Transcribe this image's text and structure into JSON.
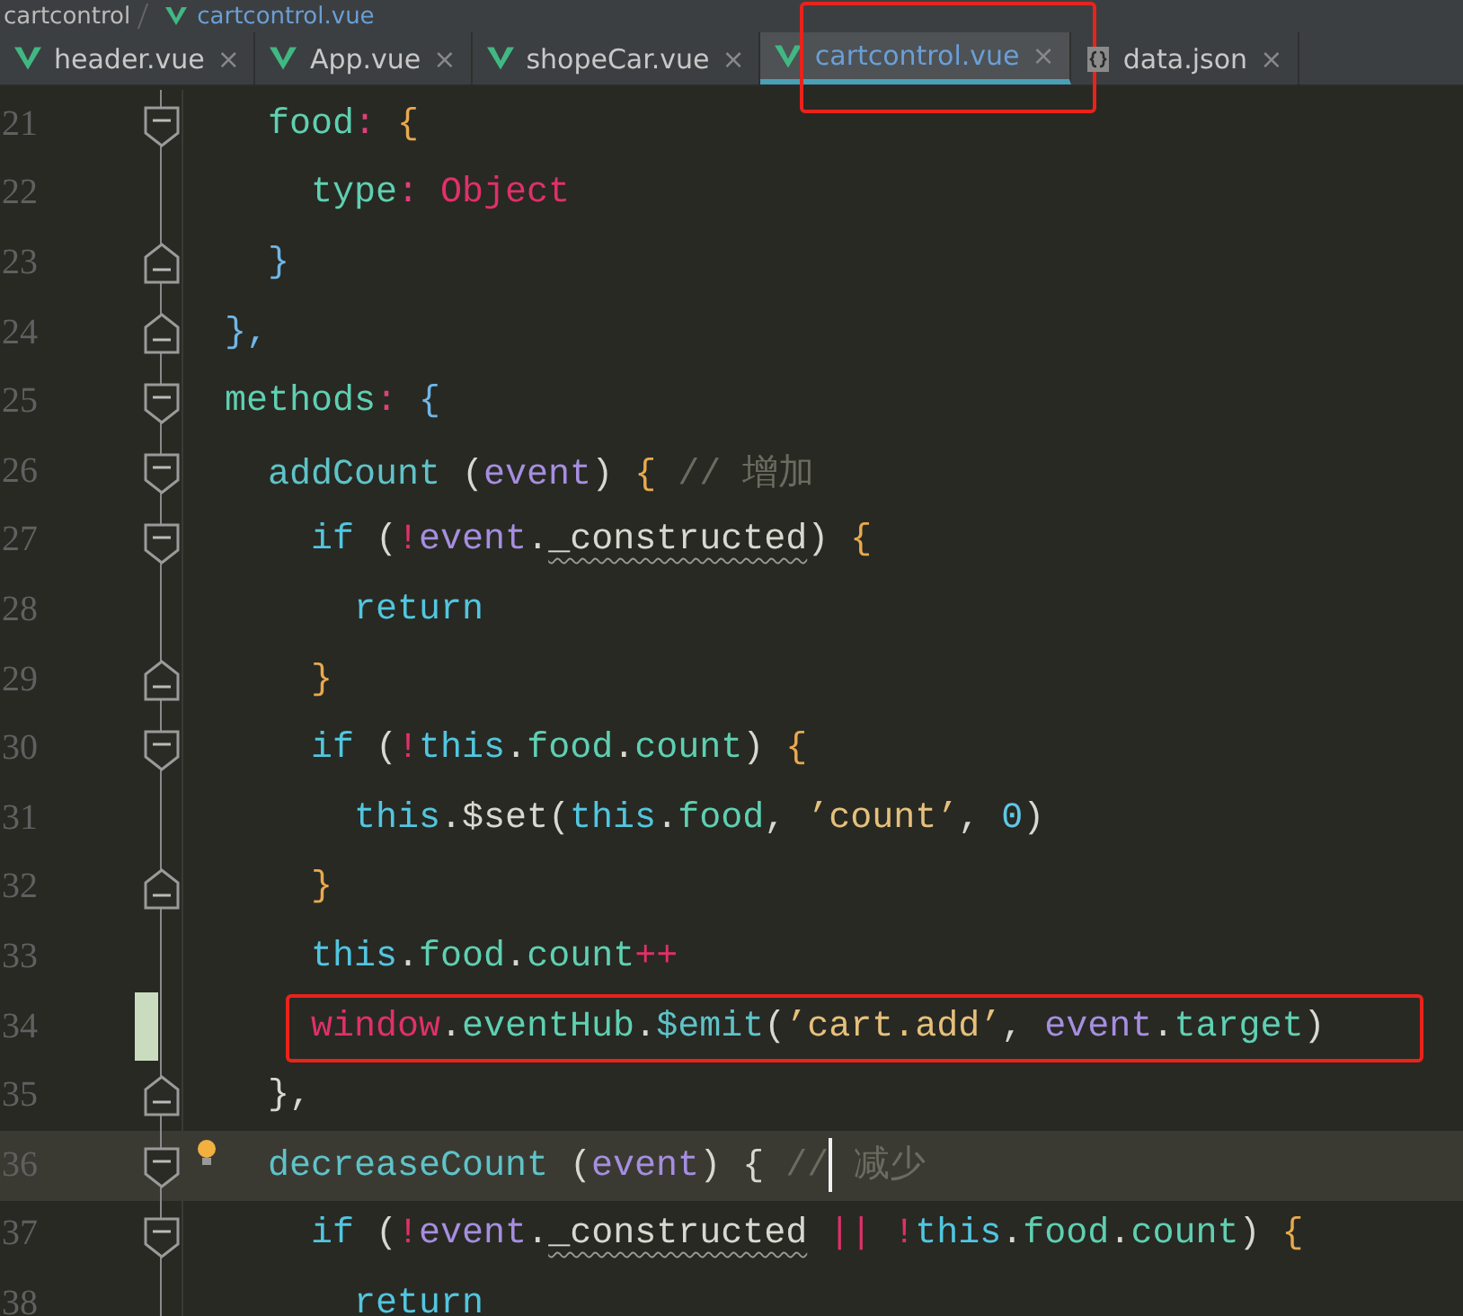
{
  "breadcrumb": [
    "cartcontrol",
    "cartcontrol.vue"
  ],
  "tabs": [
    {
      "kind": "vue",
      "label": "header.vue",
      "close": "×",
      "selected": false,
      "annotated": false
    },
    {
      "kind": "vue",
      "label": "App.vue",
      "close": "×",
      "selected": false,
      "annotated": false
    },
    {
      "kind": "vue",
      "label": "shopeCar.vue",
      "close": "×",
      "selected": false,
      "annotated": false
    },
    {
      "kind": "vue",
      "label": "cartcontrol.vue",
      "close": "×",
      "selected": true,
      "annotated": true
    },
    {
      "kind": "json",
      "label": "data.json",
      "close": "×",
      "selected": false,
      "annotated": false
    }
  ],
  "lines": [
    {
      "number": "21",
      "fold_start": true,
      "tokens": [
        {
          "key": "  food"
        },
        {
          "punct": ": "
        },
        {
          "brace_a": "{"
        }
      ]
    },
    {
      "number": "22",
      "tokens": [
        {
          "key": "    type"
        },
        {
          "punct": ": "
        },
        {
          "builtin": "Object"
        }
      ]
    },
    {
      "number": "23",
      "fold_end": true,
      "tokens": [
        {
          "brace_b": "  }"
        }
      ]
    },
    {
      "number": "24",
      "fold_end": true,
      "tokens": [
        {
          "brace_b": "},"
        }
      ]
    },
    {
      "number": "25",
      "fold_start": true,
      "tokens": [
        {
          "key": "methods"
        },
        {
          "punct": ": "
        },
        {
          "brace_b": "{"
        }
      ]
    },
    {
      "number": "26",
      "fold_start": true,
      "tokens": [
        {
          "method": "  addCount"
        },
        {
          "plain": " ("
        },
        {
          "param": "event"
        },
        {
          "plain": ") "
        },
        {
          "brace_a": "{"
        },
        {
          "comment": " // 增加"
        }
      ]
    },
    {
      "number": "27",
      "fold_start": true,
      "tokens": [
        {
          "keyword": "    if"
        },
        {
          "plain": " ("
        },
        {
          "op": "!"
        },
        {
          "param": "event"
        },
        {
          "plain": "."
        },
        {
          "warning": "_constructed"
        },
        {
          "plain": ") "
        },
        {
          "brace_a": "{"
        }
      ]
    },
    {
      "number": "28",
      "tokens": [
        {
          "keyword": "      return"
        }
      ]
    },
    {
      "number": "29",
      "fold_end": true,
      "tokens": [
        {
          "brace_a": "    }"
        }
      ]
    },
    {
      "number": "30",
      "fold_start": true,
      "tokens": [
        {
          "keyword": "    if"
        },
        {
          "plain": " ("
        },
        {
          "op": "!"
        },
        {
          "keyword": "this"
        },
        {
          "plain": "."
        },
        {
          "key": "food"
        },
        {
          "plain": "."
        },
        {
          "key": "count"
        },
        {
          "plain": ") "
        },
        {
          "brace_a": "{"
        }
      ]
    },
    {
      "number": "31",
      "tokens": [
        {
          "keyword": "      this"
        },
        {
          "plain": ".$set("
        },
        {
          "keyword": "this"
        },
        {
          "plain": "."
        },
        {
          "key": "food"
        },
        {
          "plain": ", "
        },
        {
          "string": "’count’"
        },
        {
          "plain": ", "
        },
        {
          "number": "0"
        },
        {
          "plain": ")"
        }
      ]
    },
    {
      "number": "32",
      "fold_end": true,
      "tokens": [
        {
          "brace_a": "    }"
        }
      ]
    },
    {
      "number": "33",
      "tokens": [
        {
          "keyword": "    this"
        },
        {
          "plain": "."
        },
        {
          "key": "food"
        },
        {
          "plain": "."
        },
        {
          "key": "count"
        },
        {
          "op": "++"
        }
      ]
    },
    {
      "number": "34",
      "changed": true,
      "annotated": true,
      "tokens": [
        {
          "builtin": "    window"
        },
        {
          "plain": "."
        },
        {
          "key": "eventHub"
        },
        {
          "plain": "."
        },
        {
          "method": "$emit"
        },
        {
          "plain": "("
        },
        {
          "string": "’cart.add’"
        },
        {
          "plain": ", "
        },
        {
          "param": "event"
        },
        {
          "plain": "."
        },
        {
          "key": "target"
        },
        {
          "plain": ")"
        }
      ]
    },
    {
      "number": "35",
      "fold_end": true,
      "tokens": [
        {
          "plain": "  },"
        }
      ]
    },
    {
      "number": "36",
      "fold_start": true,
      "current": true,
      "bulb": true,
      "tokens": [
        {
          "method": "  decreaseCount"
        },
        {
          "plain": " ("
        },
        {
          "param": "event"
        },
        {
          "plain": ") { "
        },
        {
          "comment": "//",
          "caret": true
        },
        {
          "comment": " 减少"
        }
      ]
    },
    {
      "number": "37",
      "fold_start": true,
      "tokens": [
        {
          "keyword": "    if"
        },
        {
          "plain": " ("
        },
        {
          "op": "!"
        },
        {
          "param": "event"
        },
        {
          "plain": "."
        },
        {
          "warning": "_constructed"
        },
        {
          "op": " || !"
        },
        {
          "keyword": "this"
        },
        {
          "plain": "."
        },
        {
          "key": "food"
        },
        {
          "plain": "."
        },
        {
          "key": "count"
        },
        {
          "plain": ") "
        },
        {
          "brace_a": "{"
        }
      ]
    },
    {
      "number": "38",
      "tokens": [
        {
          "keyword": "      return"
        }
      ]
    }
  ]
}
